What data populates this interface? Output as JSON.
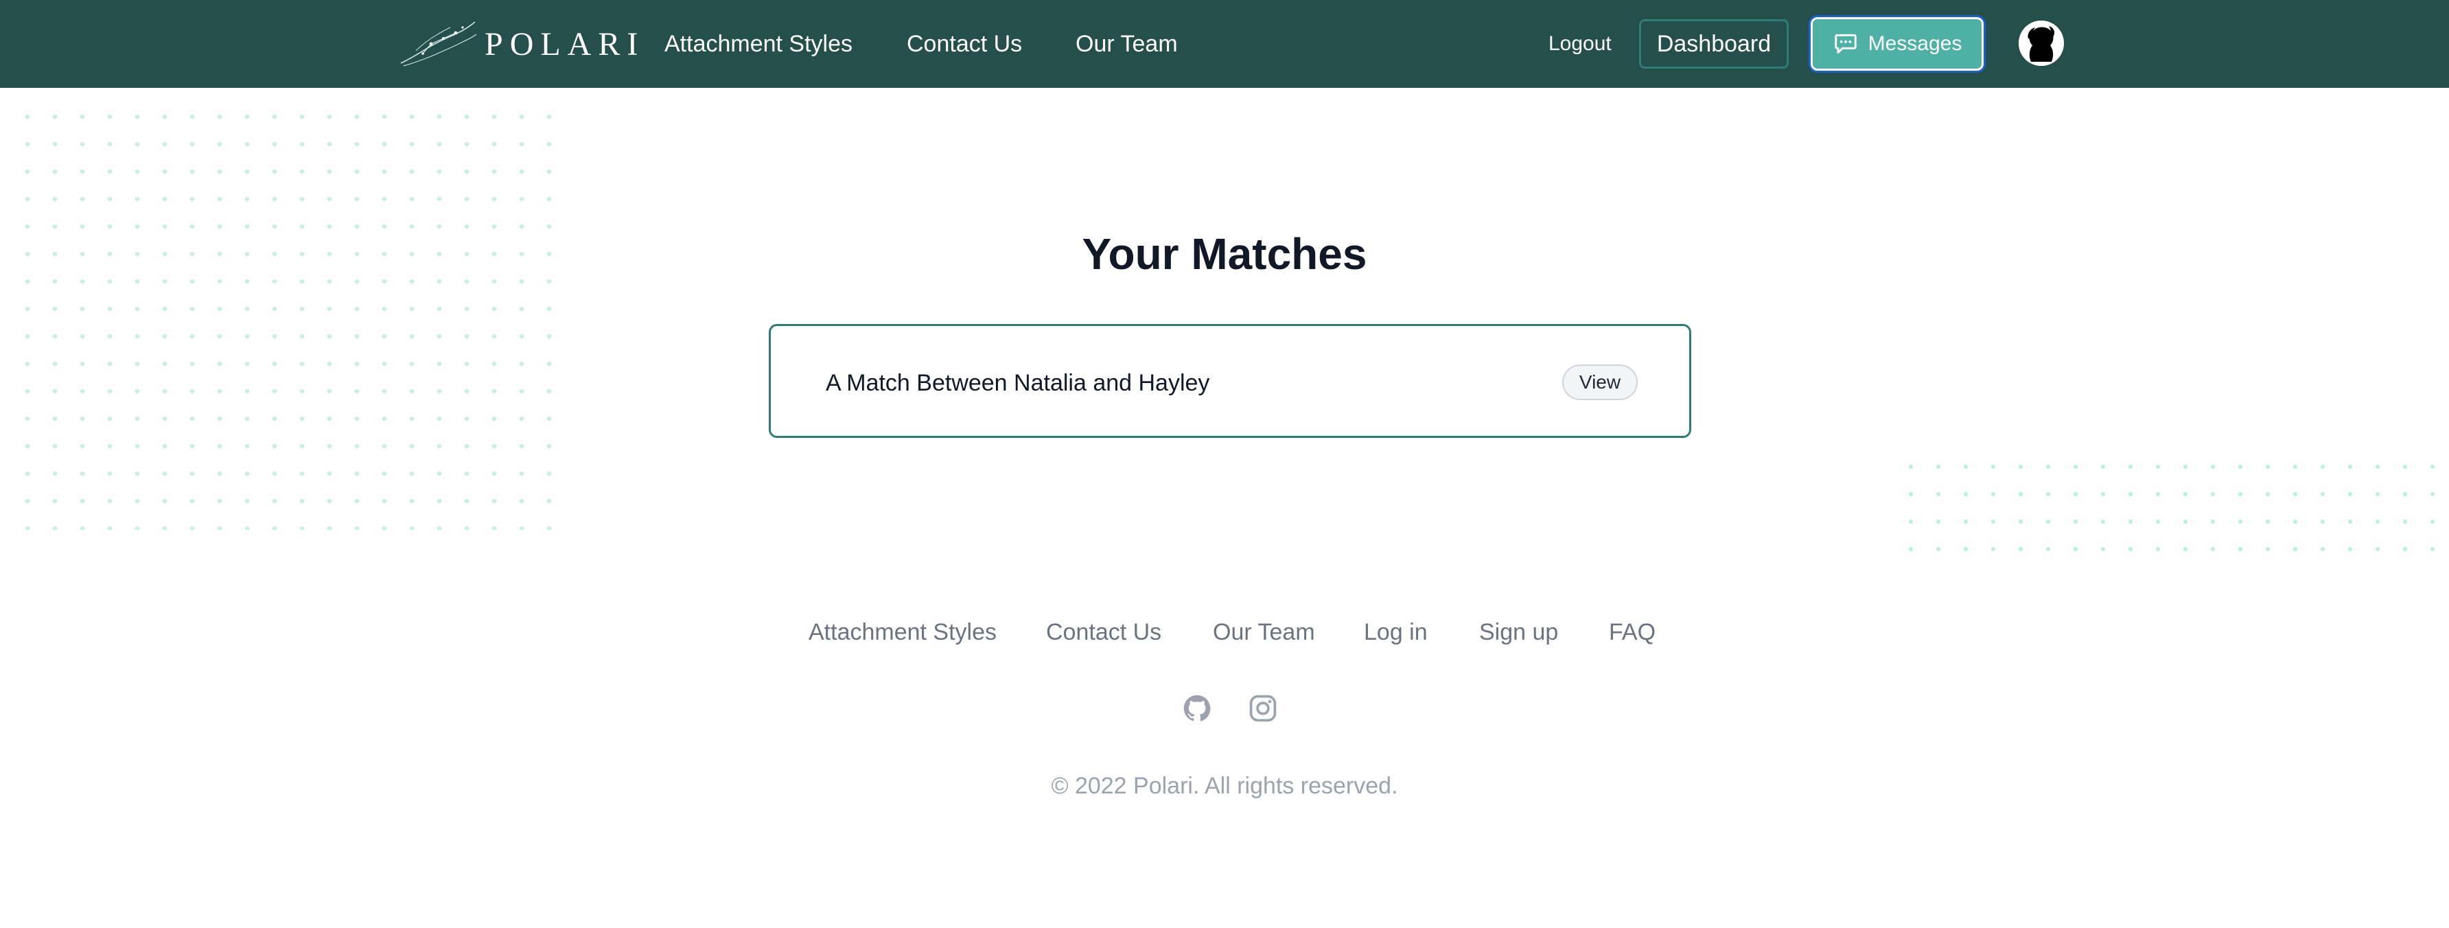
{
  "header": {
    "brand": "POLARI",
    "nav": [
      "Attachment Styles",
      "Contact Us",
      "Our Team"
    ],
    "logout": "Logout",
    "dashboard": "Dashboard",
    "messages": "Messages",
    "avatar_icon": "user-silhouette-icon"
  },
  "main": {
    "title": "Your Matches",
    "matches": [
      {
        "label": "A Match Between Natalia and Hayley",
        "action": "View"
      }
    ]
  },
  "footer": {
    "links": [
      "Attachment Styles",
      "Contact Us",
      "Our Team",
      "Log in",
      "Sign up",
      "FAQ"
    ],
    "social_icons": [
      "github-icon",
      "instagram-icon"
    ],
    "copyright": "© 2022 Polari. All rights reserved."
  },
  "colors": {
    "nav_bg": "#244f4a",
    "accent": "#4fb0a6",
    "card_border": "#2e7d74",
    "dot": "#c6f0e6"
  }
}
